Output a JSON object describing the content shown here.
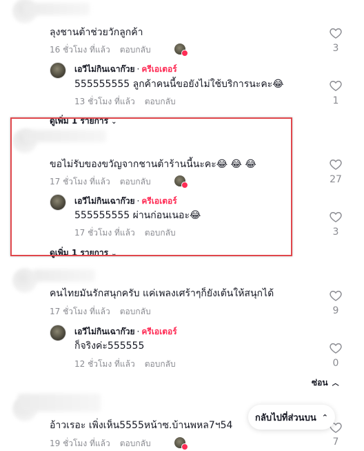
{
  "accent_color": "#fe2c55",
  "reply_label": "ตอบกลับ",
  "comments": [
    {
      "text": "ลุงชานต้าช่วยวักลูกค้า",
      "time": "16 ชั่วโมง ที่แล้ว",
      "likes": "3",
      "reply": {
        "author": "เอวีไม่กินเฉาก๊วย",
        "badge": "ครีเอเตอร์",
        "text": "555555555 ลูกค้าคนนี้ขอยังไม่ใช้บริการนะคะ😂",
        "time": "13 ชั่วโมง ที่แล้ว",
        "likes": "1"
      },
      "view_more": "ดูเพิ่ม 1 รายการ"
    },
    {
      "text": "ขอไม่รับของขวัญจากชานต้าร้านนี้นะคะ😂 😂 😂",
      "time": "17 ชั่วโมง ที่แล้ว",
      "likes": "27",
      "reply": {
        "author": "เอวีไม่กินเฉาก๊วย",
        "badge": "ครีเอเตอร์",
        "text": "555555555 ผ่านก่อนเนอะ😂",
        "time": "17 ชั่วโมง ที่แล้ว",
        "likes": "3"
      },
      "view_more": "ดูเพิ่ม 1 รายการ"
    },
    {
      "text": "คนไทยมันรักสนุกครับ แค่เพลงเศร้าๆก็ยังเต้นให้สนุกได้",
      "time": "17 ชั่วโมง ที่แล้ว",
      "likes": "9",
      "reply": {
        "author": "เอวีไม่กินเฉาก๊วย",
        "badge": "ครีเอเตอร์",
        "text": "ก็จริงค่ะ555555",
        "time": "12 ชั่วโมง ที่แล้ว",
        "likes": "0"
      },
      "hide": "ซ่อน"
    },
    {
      "text": "อ้าวเรอะ เพิ่งเห็น5555หน้าซ.บ้านพหล7ฯ54",
      "time": "19 ชั่วโมง ที่แล้ว",
      "likes": "7"
    }
  ],
  "back_to_top": "กลับไปที่ส่วนบน",
  "icons": {
    "like": "heart-outline-icon",
    "chevron": "chevron-down-icon",
    "up": "chevron-up-icon"
  }
}
